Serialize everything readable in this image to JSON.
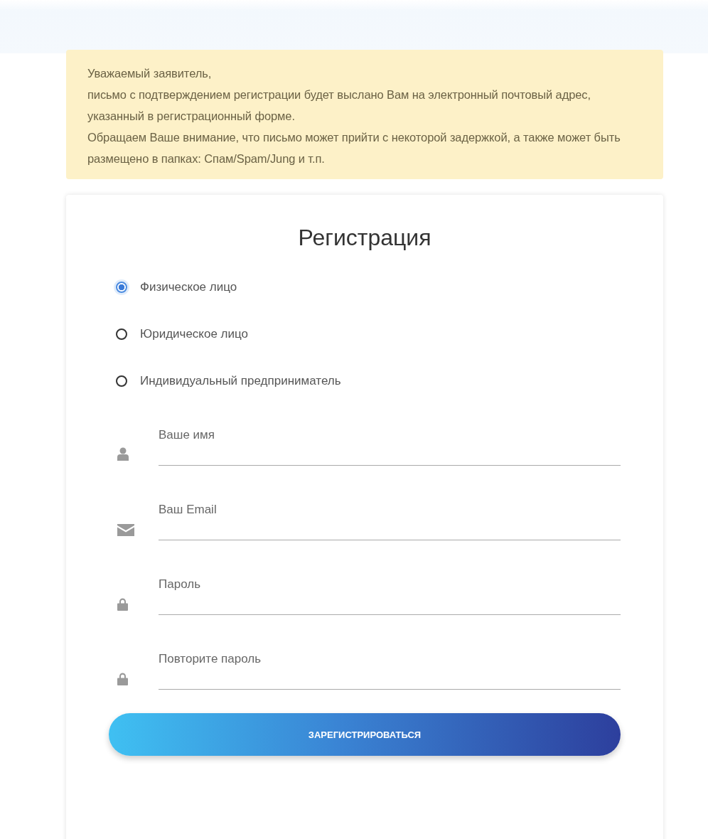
{
  "notice": {
    "paragraphs": [
      "Уважаемый заявитель,",
      "письмо с подтверждением регистрации будет выслано Вам на электронный почтовый адрес, указанный в регистрационный форме.",
      "Обращаем Ваше внимание, что письмо может прийти с некоторой задержкой, а также может быть размещено в папках: Спам/Spam/Jung и т.п."
    ]
  },
  "form": {
    "title": "Регистрация",
    "account_types": [
      {
        "label": "Физическое лицо",
        "selected": true
      },
      {
        "label": "Юридическое лицо",
        "selected": false
      },
      {
        "label": "Индивидуальный предприниматель",
        "selected": false
      }
    ],
    "fields": [
      {
        "kind": "person",
        "placeholder": "Ваше имя"
      },
      {
        "kind": "email",
        "placeholder": "Ваш Email"
      },
      {
        "kind": "password",
        "placeholder": "Пароль"
      },
      {
        "kind": "password",
        "placeholder": "Повторите пароль"
      }
    ],
    "submit": "ЗАРЕГИСТРИРОВАТЬСЯ"
  }
}
